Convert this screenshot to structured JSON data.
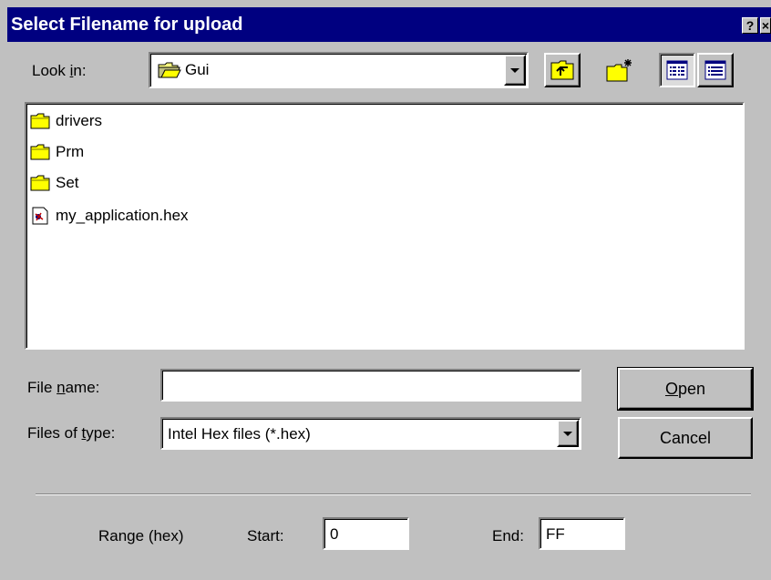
{
  "window": {
    "title": "Select Filename for upload",
    "help_glyph": "?",
    "close_glyph": "×"
  },
  "lookin": {
    "label_pre": "Look ",
    "label_key": "i",
    "label_post": "n:",
    "value": "Gui",
    "folder_icon": "open-folder-icon"
  },
  "toolbar": {
    "up_icon": "up-one-level-icon",
    "new_folder_icon": "new-folder-icon",
    "list_icon": "list-view-icon",
    "details_icon": "details-view-icon"
  },
  "files": [
    {
      "name": "drivers",
      "icon": "folder-icon"
    },
    {
      "name": "Prm",
      "icon": "folder-icon"
    },
    {
      "name": "Set",
      "icon": "folder-icon"
    },
    {
      "name": "my_application.hex",
      "icon": "hex-file-icon"
    }
  ],
  "filename": {
    "label_pre": "File ",
    "label_key": "n",
    "label_post": "ame:",
    "value": ""
  },
  "filetype": {
    "label_pre": "Files of ",
    "label_key": "t",
    "label_post": "ype:",
    "value": "Intel Hex files (*.hex)"
  },
  "buttons": {
    "open_key": "O",
    "open_rest": "pen",
    "cancel": "Cancel"
  },
  "range": {
    "label": "Range (hex)",
    "start_label": "Start:",
    "start_value": "0",
    "end_label": "End:",
    "end_value": "FF"
  }
}
